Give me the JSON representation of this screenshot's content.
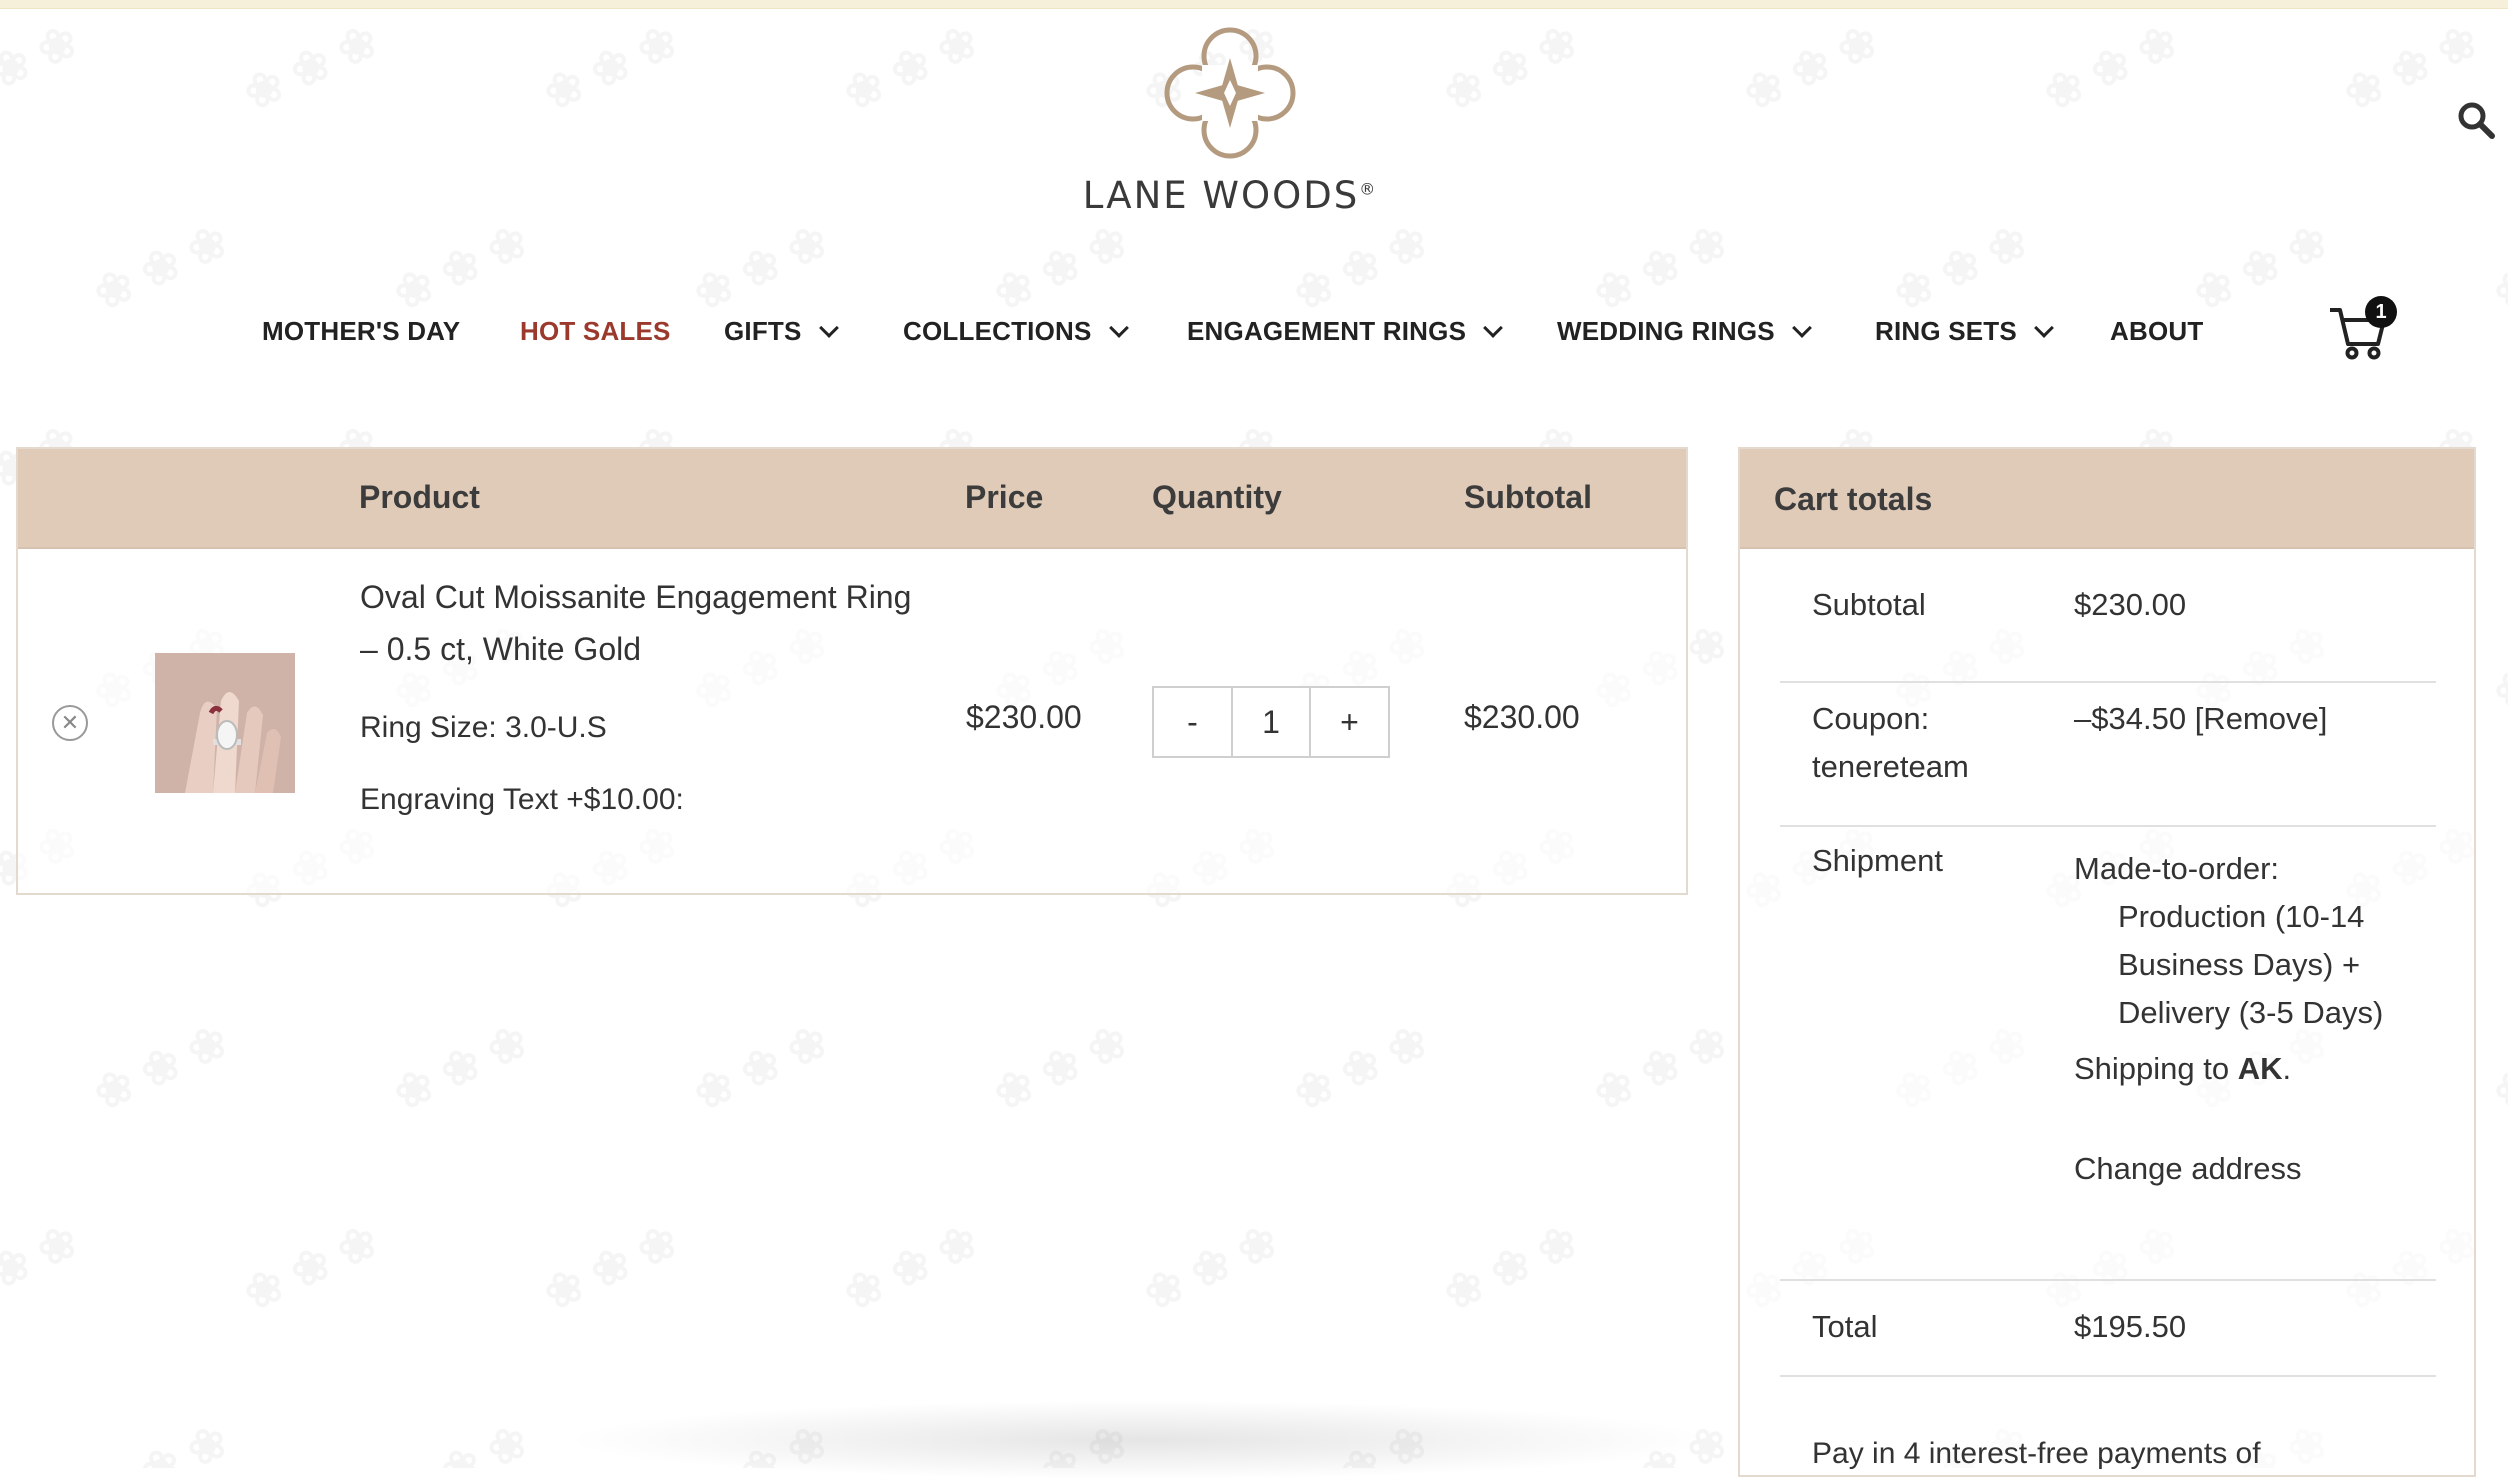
{
  "header": {
    "brand": "LANE WOODS",
    "brand_mark": "®"
  },
  "nav": {
    "items": [
      {
        "label": "MOTHER'S DAY",
        "dropdown": false
      },
      {
        "label": "HOT SALES",
        "dropdown": false
      },
      {
        "label": "GIFTS",
        "dropdown": true
      },
      {
        "label": "COLLECTIONS",
        "dropdown": true
      },
      {
        "label": "ENGAGEMENT RINGS",
        "dropdown": true
      },
      {
        "label": "WEDDING RINGS",
        "dropdown": true
      },
      {
        "label": "RING SETS",
        "dropdown": true
      },
      {
        "label": "ABOUT",
        "dropdown": false
      }
    ],
    "cart_count": "1"
  },
  "cart": {
    "headers": {
      "product": "Product",
      "price": "Price",
      "quantity": "Quantity",
      "subtotal": "Subtotal"
    },
    "item": {
      "name": "Oval Cut Moissanite Engagement Ring – 0.5 ct, White Gold",
      "ring_size": "Ring Size: 3.0-U.S",
      "engraving": "Engraving Text +$10.00:",
      "price": "$230.00",
      "quantity": "1",
      "minus": "-",
      "plus": "+",
      "subtotal": "$230.00"
    }
  },
  "totals": {
    "title": "Cart totals",
    "subtotal_label": "Subtotal",
    "subtotal_value": "$230.00",
    "coupon_label_1": "Coupon:",
    "coupon_label_2": "tenereteam",
    "coupon_value": "–$34.50",
    "coupon_remove": "[Remove]",
    "shipment_label": "Shipment",
    "ship_line1": "Made-to-order:",
    "ship_line2": "Production (10-14",
    "ship_line3": "Business Days) +",
    "ship_line4": "Delivery (3-5 Days)",
    "shipping_to": "Shipping to",
    "shipping_state": "AK",
    "change_address": "Change address",
    "total_label": "Total",
    "total_value": "$195.50",
    "pay_in_4": "Pay in 4 interest-free payments of"
  },
  "colors": {
    "header_bg": "#e0cbb8",
    "hot_sales": "#9b3a2c",
    "logo": "#b49a7e"
  }
}
